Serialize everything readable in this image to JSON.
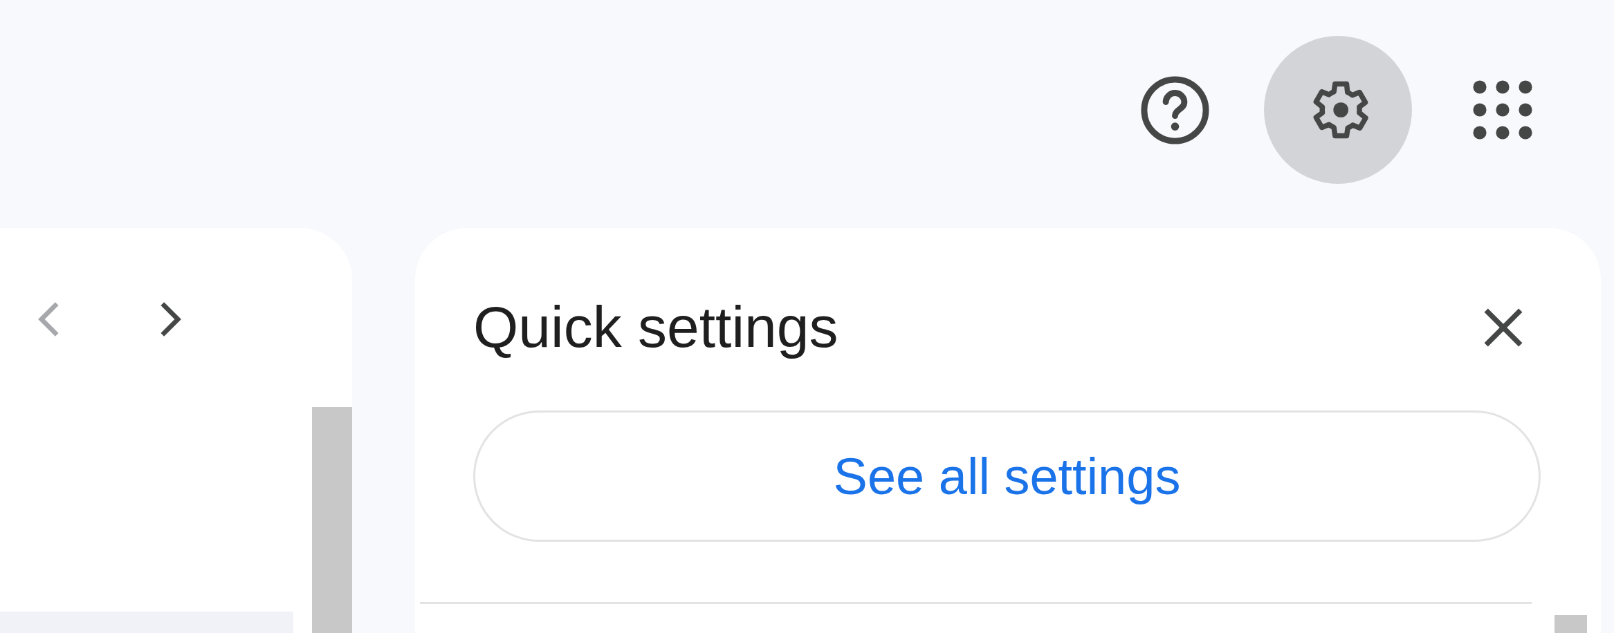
{
  "toolbar": {
    "help_button": {
      "selected": false
    },
    "settings_button": {
      "selected": true
    }
  },
  "pager": [
    {
      "kind": "prev",
      "disabled": true
    },
    {
      "kind": "next",
      "disabled": false
    }
  ],
  "quick_settings": {
    "title": "Quick settings",
    "button": "See all settings"
  }
}
